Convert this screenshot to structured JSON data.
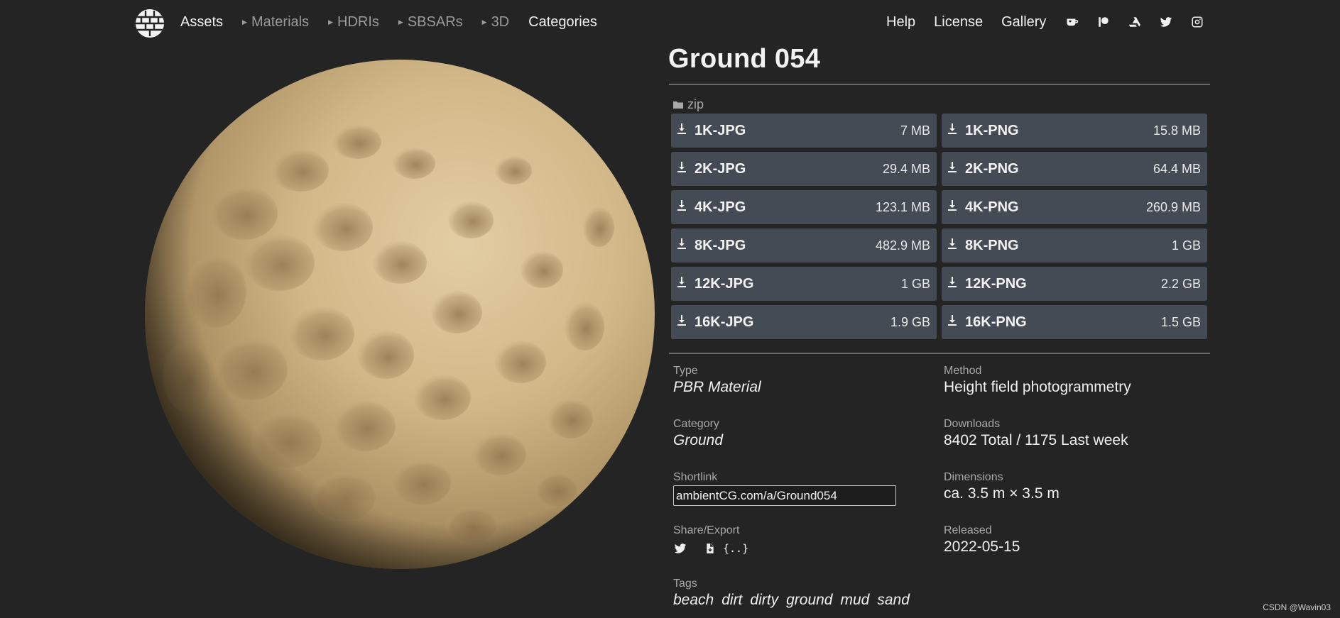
{
  "nav": {
    "brand": "Assets",
    "items": [
      {
        "label": "Materials",
        "has_caret": true
      },
      {
        "label": "HDRIs",
        "has_caret": true
      },
      {
        "label": "SBSARs",
        "has_caret": true
      },
      {
        "label": "3D",
        "has_caret": true
      }
    ],
    "categories": "Categories",
    "right_links": [
      "Help",
      "License",
      "Gallery"
    ],
    "social_icons": [
      "kofi-icon",
      "patreon-icon",
      "artstation-icon",
      "twitter-icon",
      "instagram-icon"
    ]
  },
  "asset": {
    "title": "Ground 054",
    "zip_label": "zip",
    "downloads": [
      {
        "label": "1K-JPG",
        "size": "7 MB"
      },
      {
        "label": "1K-PNG",
        "size": "15.8 MB"
      },
      {
        "label": "2K-JPG",
        "size": "29.4 MB"
      },
      {
        "label": "2K-PNG",
        "size": "64.4 MB"
      },
      {
        "label": "4K-JPG",
        "size": "123.1 MB"
      },
      {
        "label": "4K-PNG",
        "size": "260.9 MB"
      },
      {
        "label": "8K-JPG",
        "size": "482.9 MB"
      },
      {
        "label": "8K-PNG",
        "size": "1 GB"
      },
      {
        "label": "12K-JPG",
        "size": "1 GB"
      },
      {
        "label": "12K-PNG",
        "size": "2.2 GB"
      },
      {
        "label": "16K-JPG",
        "size": "1.9 GB"
      },
      {
        "label": "16K-PNG",
        "size": "1.5 GB"
      }
    ],
    "meta": {
      "type_label": "Type",
      "type_value": "PBR Material",
      "method_label": "Method",
      "method_value": "Height field photogrammetry",
      "category_label": "Category",
      "category_value": "Ground",
      "downloads_label": "Downloads",
      "downloads_value": "8402 Total / 1175 Last week",
      "shortlink_label": "Shortlink",
      "shortlink_value": "ambientCG.com/a/Ground054",
      "dimensions_label": "Dimensions",
      "dimensions_value": "ca. 3.5 m × 3.5 m",
      "share_label": "Share/Export",
      "json_label": "{..}",
      "released_label": "Released",
      "released_value": "2022-05-15",
      "tags_label": "Tags",
      "tags": [
        "beach",
        "dirt",
        "dirty",
        "ground",
        "mud",
        "sand"
      ]
    }
  },
  "watermark": "CSDN @Wavin03",
  "colors": {
    "background": "#242424",
    "button": "#444b54",
    "rule": "#6a6a6a",
    "sand": "#c9ae80"
  }
}
